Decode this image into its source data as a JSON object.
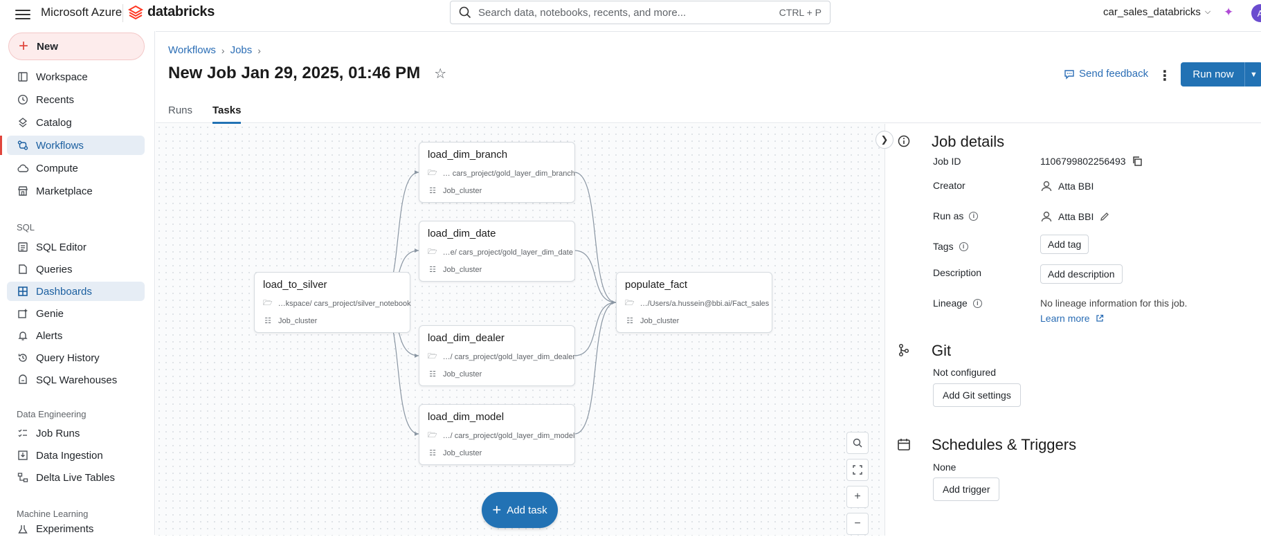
{
  "header": {
    "brand_azure": "Microsoft Azure",
    "brand_databricks": "databricks",
    "search_placeholder": "Search data, notebooks, recents, and more...",
    "search_shortcut": "CTRL + P",
    "workspace": "car_sales_databricks",
    "avatar_initial": "A"
  },
  "sidebar": {
    "new_label": "New",
    "items_top": [
      {
        "label": "Workspace",
        "icon": "workspace-icon"
      },
      {
        "label": "Recents",
        "icon": "clock-icon"
      },
      {
        "label": "Catalog",
        "icon": "catalog-icon"
      },
      {
        "label": "Workflows",
        "icon": "workflows-icon"
      },
      {
        "label": "Compute",
        "icon": "cloud-icon"
      },
      {
        "label": "Marketplace",
        "icon": "store-icon"
      }
    ],
    "sql_header": "SQL",
    "items_sql": [
      {
        "label": "SQL Editor"
      },
      {
        "label": "Queries"
      },
      {
        "label": "Dashboards"
      },
      {
        "label": "Genie"
      },
      {
        "label": "Alerts"
      },
      {
        "label": "Query History"
      },
      {
        "label": "SQL Warehouses"
      }
    ],
    "de_header": "Data Engineering",
    "items_de": [
      {
        "label": "Job Runs"
      },
      {
        "label": "Data Ingestion"
      },
      {
        "label": "Delta Live Tables"
      }
    ],
    "ml_header": "Machine Learning",
    "ml_partial": "Experiments"
  },
  "page": {
    "breadcrumb": [
      "Workflows",
      "Jobs"
    ],
    "title": "New Job Jan 29, 2025, 01:46 PM",
    "send_feedback": "Send feedback",
    "run_now": "Run now",
    "tabs": [
      "Runs",
      "Tasks"
    ],
    "active_tab": "Tasks"
  },
  "dag": {
    "nodes": [
      {
        "id": "load_to_silver",
        "name": "load_to_silver",
        "path": "…kspace/ cars_project/silver_notebook",
        "cluster": "Job_cluster"
      },
      {
        "id": "load_dim_branch",
        "name": "load_dim_branch",
        "path": "… cars_project/gold_layer_dim_branch",
        "cluster": "Job_cluster"
      },
      {
        "id": "load_dim_date",
        "name": "load_dim_date",
        "path": "…e/ cars_project/gold_layer_dim_date",
        "cluster": "Job_cluster"
      },
      {
        "id": "load_dim_dealer",
        "name": "load_dim_dealer",
        "path": "…/ cars_project/gold_layer_dim_dealer",
        "cluster": "Job_cluster"
      },
      {
        "id": "load_dim_model",
        "name": "load_dim_model",
        "path": "…/ cars_project/gold_layer_dim_model",
        "cluster": "Job_cluster"
      },
      {
        "id": "populate_fact",
        "name": "populate_fact",
        "path": "…/Users/a.hussein@bbi.ai/Fact_sales",
        "cluster": "Job_cluster"
      }
    ],
    "add_task": "Add task"
  },
  "details": {
    "title": "Job details",
    "job_id_label": "Job ID",
    "job_id": "1106799802256493",
    "creator_label": "Creator",
    "creator": "Atta BBI",
    "run_as_label": "Run as",
    "run_as": "Atta BBI",
    "tags_label": "Tags",
    "add_tag": "Add tag",
    "description_label": "Description",
    "add_description": "Add description",
    "lineage_label": "Lineage",
    "lineage_text": "No lineage information for this job.",
    "learn_more": "Learn more"
  },
  "git": {
    "title": "Git",
    "status": "Not configured",
    "button": "Add Git settings"
  },
  "schedules": {
    "title": "Schedules & Triggers",
    "status": "None",
    "button": "Add trigger"
  }
}
